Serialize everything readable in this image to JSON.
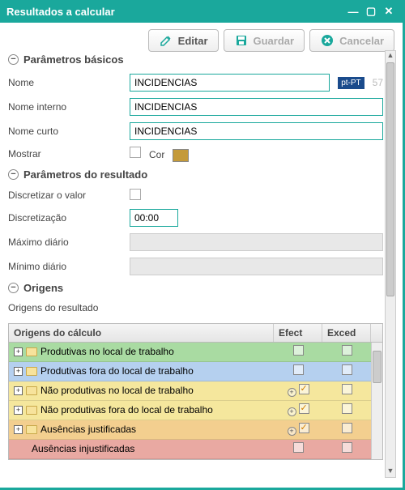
{
  "window": {
    "title": "Resultados a calcular"
  },
  "toolbar": {
    "edit": "Editar",
    "save": "Guardar",
    "cancel": "Cancelar"
  },
  "sections": {
    "basic": "Parâmetros básicos",
    "result": "Parâmetros do resultado",
    "origins": "Origens"
  },
  "fields": {
    "name_lbl": "Nome",
    "name_val": "INCIDENCIAS",
    "lang": "pt-PT",
    "id": "57",
    "iname_lbl": "Nome interno",
    "iname_val": "INCIDENCIAS",
    "sname_lbl": "Nome curto",
    "sname_val": "INCIDENCIAS",
    "show_lbl": "Mostrar",
    "color_lbl": "Cor",
    "discretize_lbl": "Discretizar o valor",
    "discretization_lbl": "Discretização",
    "discretization_val": "00:00",
    "maxd_lbl": "Máximo diário",
    "maxd_val": "",
    "mind_lbl": "Mínimo diário",
    "mind_val": ""
  },
  "origins_label": "Origens do resultado",
  "grid": {
    "h1": "Origens do cálculo",
    "h2": "Efect",
    "h3": "Exced",
    "rows": [
      {
        "label": "Produtivas no local de trabalho",
        "cls": "bg-green",
        "efect": false,
        "exced": false,
        "expand": false
      },
      {
        "label": "Produtivas fora do local de trabalho",
        "cls": "bg-blue",
        "efect": false,
        "exced": false,
        "expand": false
      },
      {
        "label": "Não produtivas no local de trabalho",
        "cls": "bg-yellow",
        "efect": true,
        "exced": false,
        "expand": true
      },
      {
        "label": "Não produtivas fora do local de trabalho",
        "cls": "bg-yellow",
        "efect": true,
        "exced": false,
        "expand": true
      },
      {
        "label": "Ausências justificadas",
        "cls": "bg-orange",
        "efect": true,
        "exced": false,
        "expand": true
      },
      {
        "label": "Ausências injustificadas",
        "cls": "bg-red",
        "efect": false,
        "exced": false,
        "expand": false,
        "indent": true
      }
    ]
  }
}
